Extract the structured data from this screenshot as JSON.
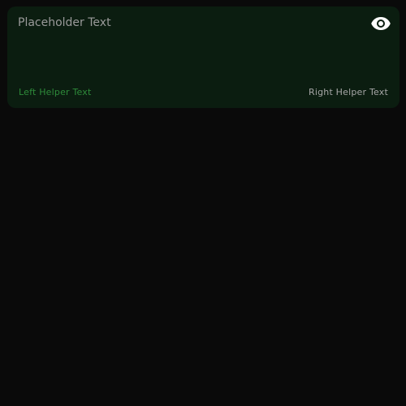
{
  "text_field": {
    "value": "",
    "placeholder": "Placeholder Text",
    "left_helper": "Left Helper Text",
    "right_helper": "Right Helper Text",
    "toggle_icon": "eye-icon"
  },
  "colors": {
    "page_background": "#0a0a0a",
    "field_background": "#0b1d10",
    "placeholder_text": "#9a9a9a",
    "left_helper_text": "#2e8b3a",
    "right_helper_text": "#a6a6a6",
    "icon": "#ffffff"
  }
}
